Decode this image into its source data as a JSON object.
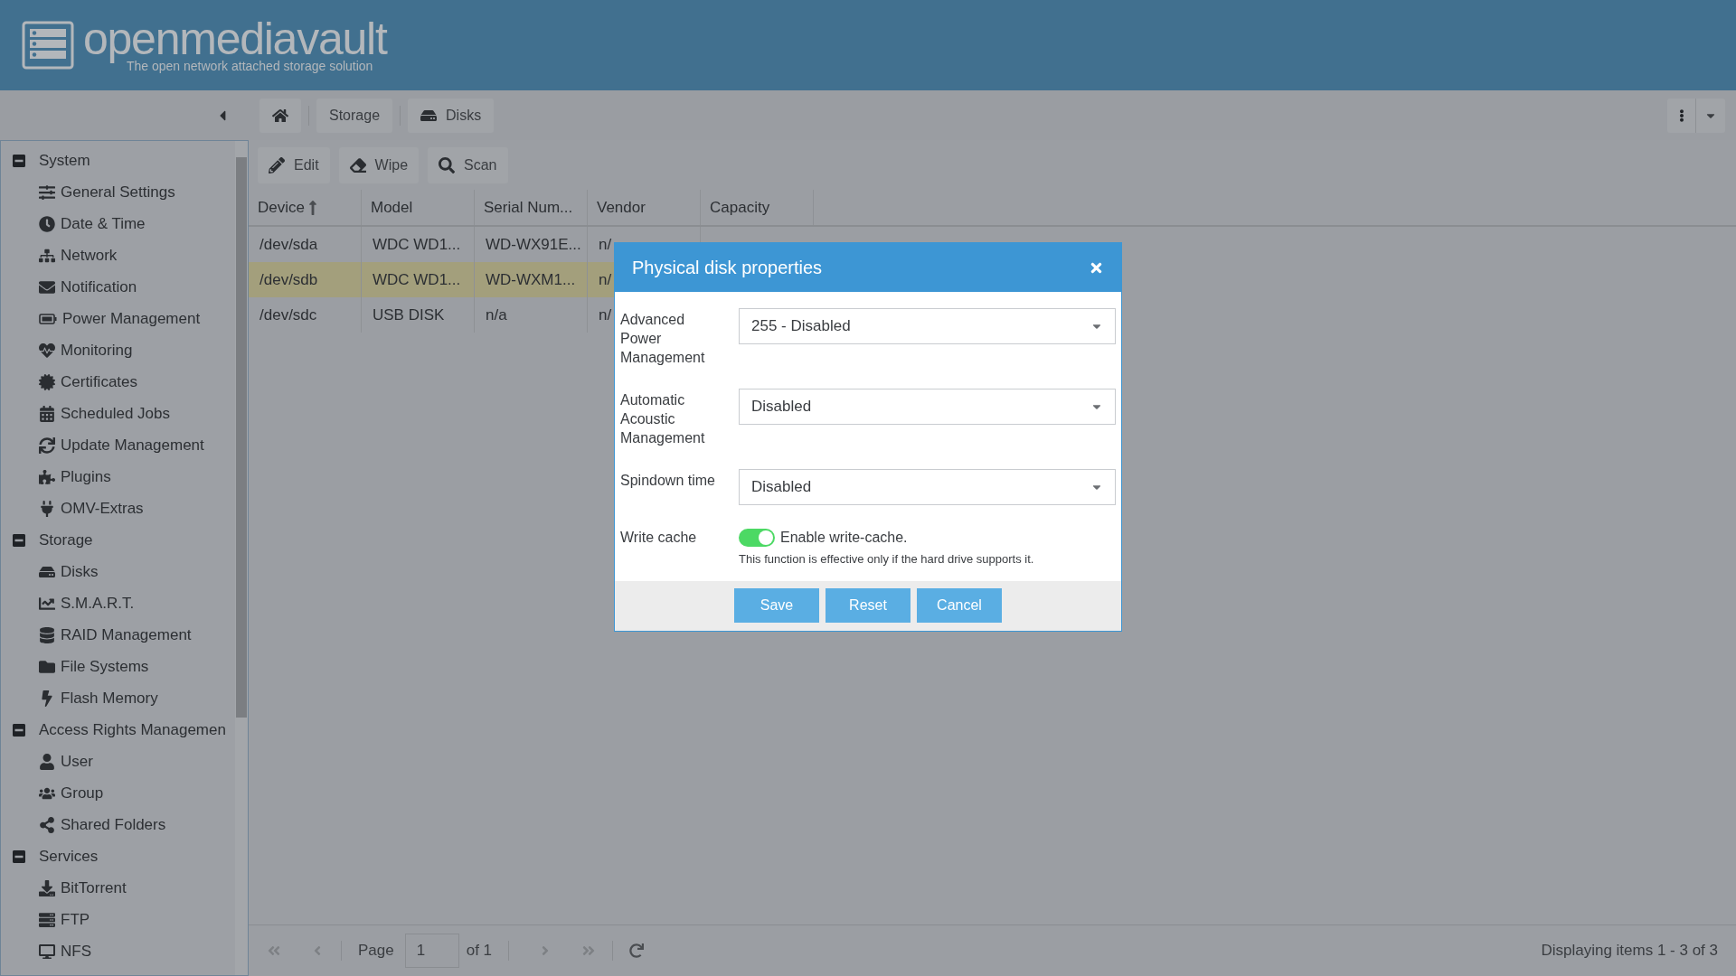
{
  "header": {
    "logo_text": "openmediavault",
    "tagline": "The open network attached storage solution"
  },
  "breadcrumb": [
    {
      "kind": "home"
    },
    {
      "kind": "text",
      "label": "Storage"
    },
    {
      "kind": "text",
      "label": "Disks"
    }
  ],
  "sidebar": {
    "groups": [
      {
        "label": "System",
        "expanded": true,
        "children": [
          {
            "label": "General Settings"
          },
          {
            "label": "Date & Time"
          },
          {
            "label": "Network"
          },
          {
            "label": "Notification"
          },
          {
            "label": "Power Management"
          },
          {
            "label": "Monitoring"
          },
          {
            "label": "Certificates"
          },
          {
            "label": "Scheduled Jobs"
          },
          {
            "label": "Update Management"
          },
          {
            "label": "Plugins"
          },
          {
            "label": "OMV-Extras"
          }
        ]
      },
      {
        "label": "Storage",
        "expanded": true,
        "children": [
          {
            "label": "Disks"
          },
          {
            "label": "S.M.A.R.T."
          },
          {
            "label": "RAID Management"
          },
          {
            "label": "File Systems"
          },
          {
            "label": "Flash Memory"
          }
        ]
      },
      {
        "label": "Access Rights Managemen",
        "expanded": true,
        "children": [
          {
            "label": "User"
          },
          {
            "label": "Group"
          },
          {
            "label": "Shared Folders"
          }
        ]
      },
      {
        "label": "Services",
        "expanded": true,
        "children": [
          {
            "label": "BitTorrent"
          },
          {
            "label": "FTP"
          },
          {
            "label": "NFS"
          }
        ]
      }
    ]
  },
  "toolbar": [
    "Edit",
    "Wipe",
    "Scan"
  ],
  "table": {
    "columns": [
      {
        "label": "Device",
        "sorted": true
      },
      {
        "label": "Model",
        "sorted": false
      },
      {
        "label": "Serial Num...",
        "sorted": false
      },
      {
        "label": "Vendor",
        "sorted": false
      },
      {
        "label": "Capacity",
        "sorted": false
      }
    ],
    "rows": [
      {
        "selected": false,
        "cells": [
          "/dev/sda",
          "WDC WD1...",
          "WD-WX91E...",
          "n/"
        ]
      },
      {
        "selected": true,
        "cells": [
          "/dev/sdb",
          "WDC WD1...",
          "WD-WXM1...",
          "n/"
        ]
      },
      {
        "selected": false,
        "cells": [
          "/dev/sdc",
          "USB DISK",
          "n/a",
          "n/"
        ]
      }
    ]
  },
  "dialog": {
    "title": "Physical disk properties",
    "fields": [
      {
        "kind": "select",
        "label": "Advanced Power Management",
        "value": "255 - Disabled"
      },
      {
        "kind": "select",
        "label": "Automatic Acoustic Management",
        "value": "Disabled"
      },
      {
        "kind": "select",
        "label": "Spindown time",
        "value": "Disabled"
      },
      {
        "kind": "toggle",
        "label": "Write cache",
        "on": true,
        "text": "Enable write-cache.",
        "hint": "This function is effective only if the hard drive supports it."
      }
    ],
    "buttons": [
      "Save",
      "Reset",
      "Cancel"
    ]
  },
  "pager": {
    "page_label": "Page",
    "page": "1",
    "of": "of 1",
    "display": "Displaying items 1 - 3 of 3"
  }
}
